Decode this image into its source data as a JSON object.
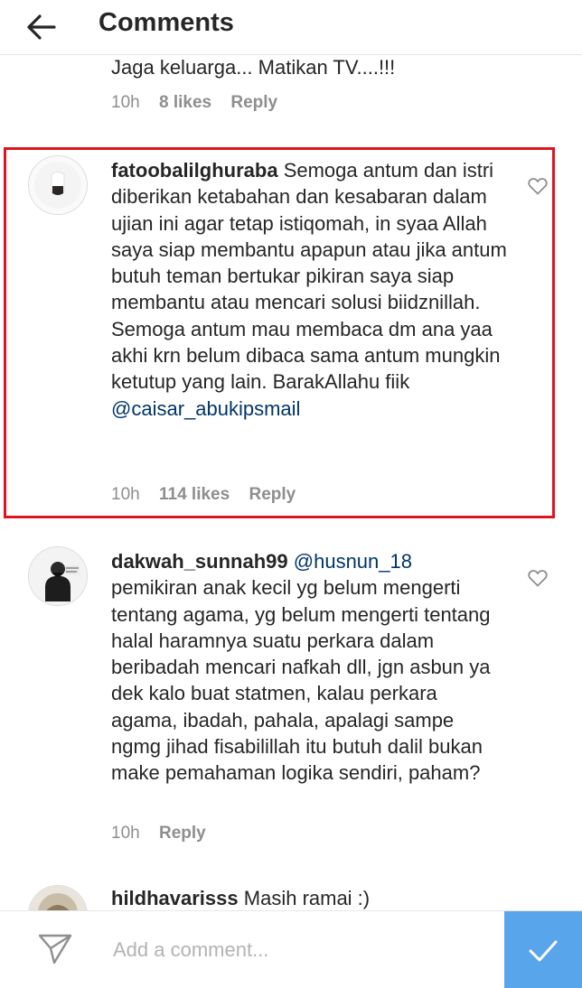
{
  "header": {
    "title": "Comments",
    "back_icon": "arrow-left-icon"
  },
  "previous_comment": {
    "text": "Jaga keluarga... Matikan TV....!!!",
    "time": "10h",
    "likes": "8 likes",
    "reply": "Reply"
  },
  "comments": [
    {
      "username": "fatoobalilghuraba",
      "text": "Semoga antum dan istri diberikan ketabahan dan kesabaran dalam ujian ini agar tetap istiqomah, in syaa Allah saya siap membantu apapun atau jika antum butuh teman bertukar pikiran saya siap membantu atau mencari solusi biidznillah. Semoga antum mau membaca dm ana yaa akhi krn belum dibaca sama antum mungkin ketutup yang lain. BarakAllahu fiik",
      "mention": "@caisar_abukipsmail",
      "time": "10h",
      "likes": "114 likes",
      "reply": "Reply",
      "highlight_color": "#e0141e"
    },
    {
      "username": "dakwah_sunnah99",
      "mention": "@husnun_18",
      "text": "pemikiran anak kecil yg belum mengerti tentang agama, yg belum mengerti tentang halal haramnya suatu perkara dalam beribadah mencari nafkah dll, jgn asbun ya dek kalo buat statmen, kalau perkara agama, ibadah, pahala, apalagi sampe ngmg jihad fisabilillah itu butuh dalil bukan make pemahaman logika sendiri, paham?",
      "time": "10h",
      "reply": "Reply"
    },
    {
      "username": "hildhavarisss",
      "text": "Masih ramai :)"
    }
  ],
  "footer": {
    "placeholder": "Add a comment...",
    "send_icon": "paper-plane-icon",
    "post_icon": "checkmark-icon",
    "accent": "#59a5ec"
  }
}
